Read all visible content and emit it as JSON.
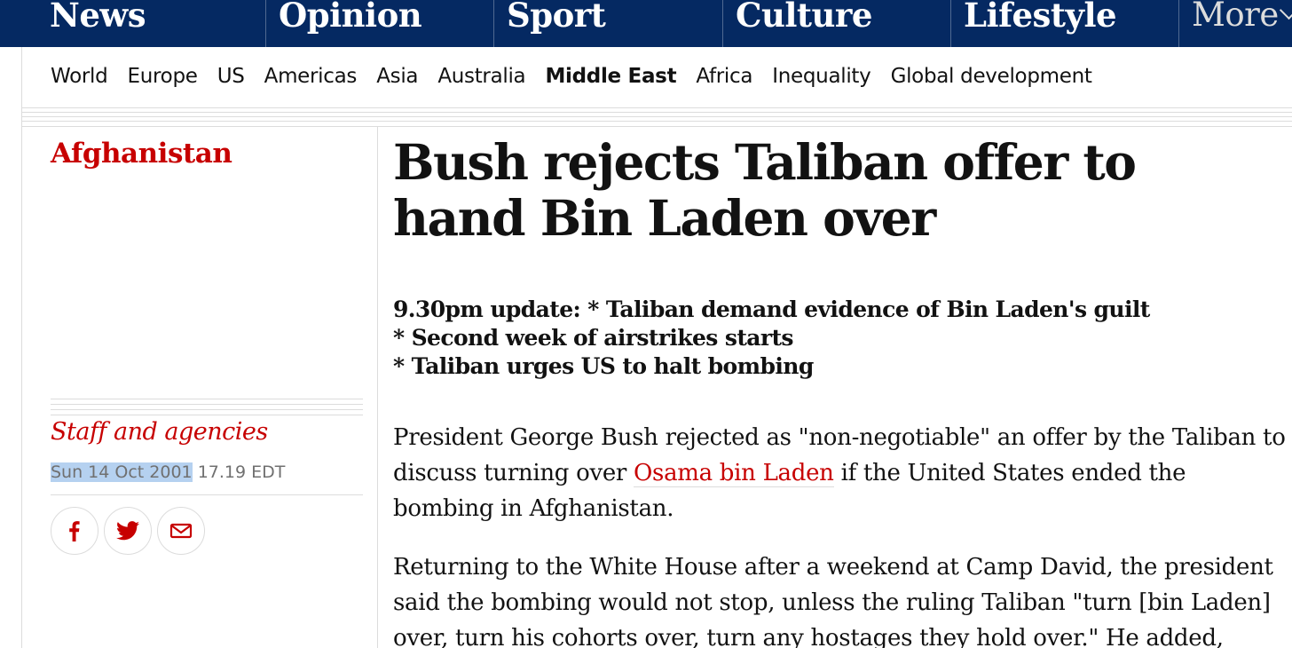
{
  "pillars": [
    {
      "label": "News"
    },
    {
      "label": "Opinion"
    },
    {
      "label": "Sport"
    },
    {
      "label": "Culture"
    },
    {
      "label": "Lifestyle"
    },
    {
      "label": "More"
    }
  ],
  "subnav": {
    "items": [
      "World",
      "Europe",
      "US",
      "Americas",
      "Asia",
      "Australia",
      "Middle East",
      "Africa",
      "Inequality",
      "Global development"
    ],
    "active": "Middle East"
  },
  "article": {
    "section": "Afghanistan",
    "byline": "Staff and agencies",
    "date_selected": "Sun 14 Oct 2001",
    "time": " 17.19 EDT",
    "headline": "Bush rejects Taliban offer to hand Bin Laden over",
    "standfirst": [
      "9.30pm update: * Taliban demand evidence of Bin Laden's guilt",
      "* Second week of airstrikes starts",
      "* Taliban urges US to halt bombing"
    ],
    "para1_before": "President George Bush rejected as \"non-negotiable\" an offer by the Taliban to discuss turning over ",
    "para1_link": "Osama bin Laden",
    "para1_after": " if the United States ended the bombing in Afghanistan.",
    "para2": "Returning to the White House after a weekend at Camp David, the president said the bombing would not stop, unless the ruling Taliban \"turn [bin Laden] over, turn his cohorts over, turn any hostages they hold over.\" He added,"
  },
  "share": [
    {
      "icon": "facebook-icon"
    },
    {
      "icon": "twitter-icon"
    },
    {
      "icon": "email-icon"
    }
  ],
  "colors": {
    "brand": "#052962",
    "accent": "#c70000",
    "selection": "#b5d1f0"
  }
}
